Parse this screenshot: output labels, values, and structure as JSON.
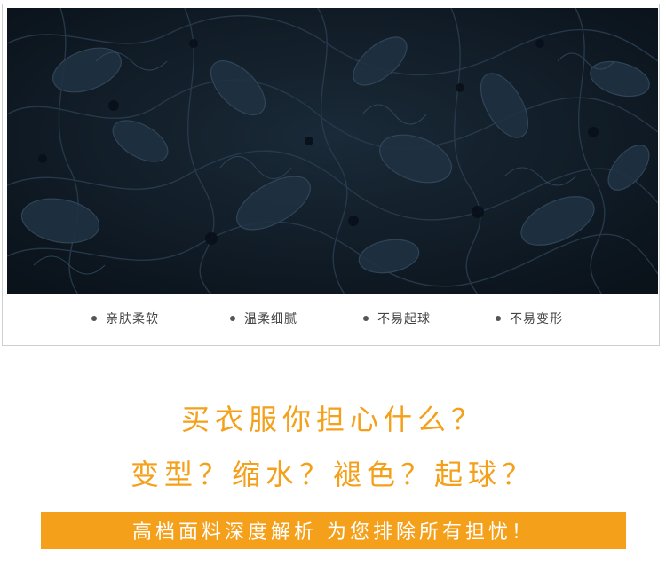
{
  "features": [
    {
      "label": "亲肤柔软"
    },
    {
      "label": "温柔细腻"
    },
    {
      "label": "不易起球"
    },
    {
      "label": "不易变形"
    }
  ],
  "headline": {
    "line1": "买衣服你担心什么？",
    "line2": "变型？缩水？褪色？起球？"
  },
  "banner": {
    "text": "高档面料深度解析 为您排除所有担忧！"
  },
  "colors": {
    "accent": "#f4a01a",
    "fabric": "#0d1620"
  }
}
